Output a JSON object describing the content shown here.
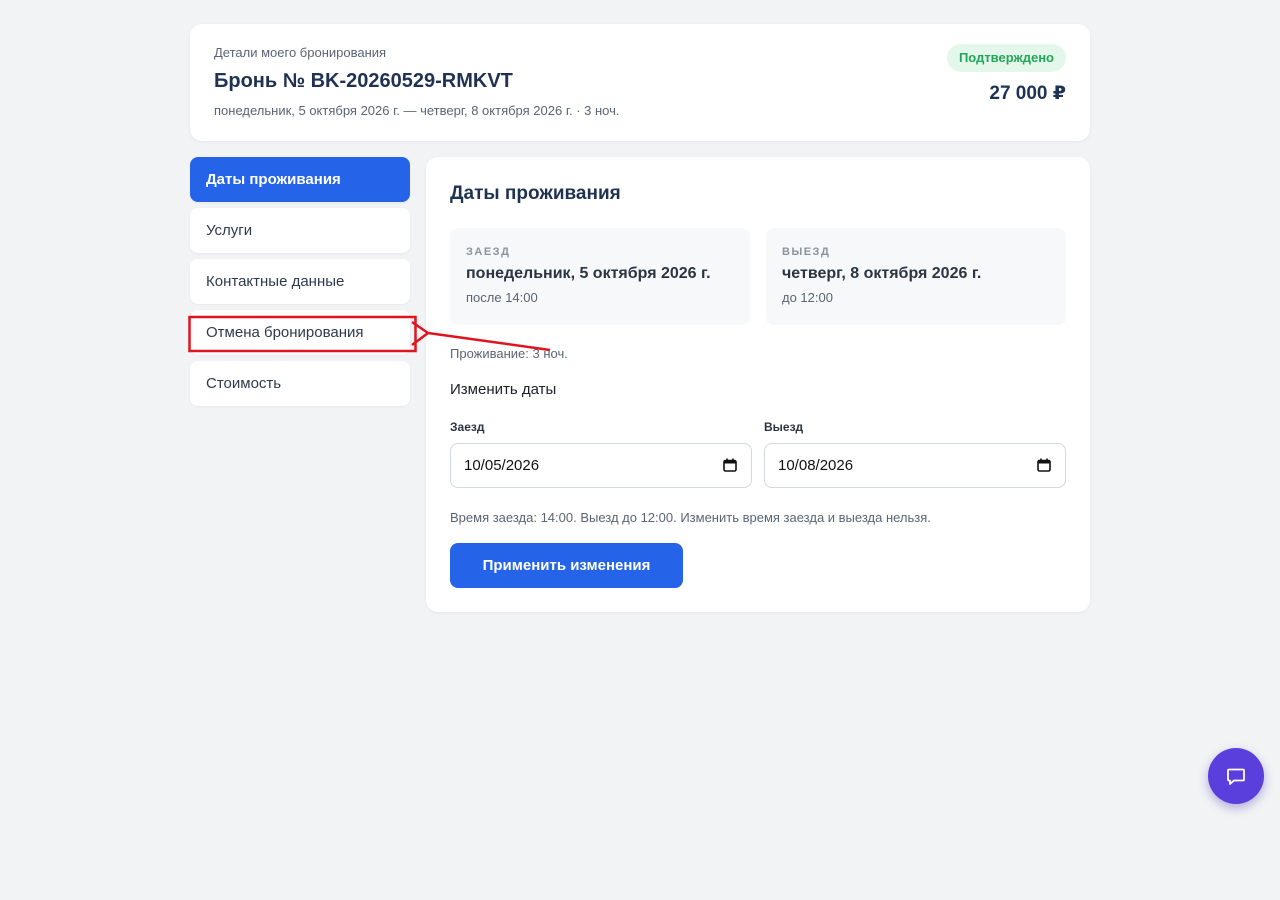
{
  "header": {
    "subtitle": "Детали моего бронирования",
    "title": "Бронь № BK-20260529-RMKVT",
    "dates": "понедельник, 5 октября 2026 г. — четверг, 8 октября 2026 г. · 3 ноч.",
    "status": "Подтверждено",
    "status_color": "#25a55a",
    "price": "27 000 ₽"
  },
  "sidebar": {
    "items": [
      {
        "label": "Даты проживания",
        "active": true
      },
      {
        "label": "Услуги",
        "active": false
      },
      {
        "label": "Контактные данные",
        "active": false
      },
      {
        "label": "Отмена бронирования",
        "active": false
      },
      {
        "label": "Стоимость",
        "active": false
      }
    ]
  },
  "main": {
    "title": "Даты проживания",
    "checkin": {
      "label": "ЗАЕЗД",
      "date": "понедельник, 5 октября 2026 г.",
      "time": "после 14:00"
    },
    "checkout": {
      "label": "ВЫЕЗД",
      "date": "четверг, 8 октября 2026 г.",
      "time": "до 12:00"
    },
    "stay": "Проживание: 3 ноч.",
    "change_title": "Изменить даты",
    "checkin_field": {
      "label": "Заезд",
      "value": "10/05/2026"
    },
    "checkout_field": {
      "label": "Выезд",
      "value": "10/08/2026"
    },
    "hint": "Время заезда: 14:00. Выезд до 12:00. Изменить время заезда и выезда нельзя.",
    "apply_label": "Применить изменения"
  },
  "colors": {
    "accent": "#2563e8",
    "chat": "#5b3fdc",
    "annotation": "#e0141e"
  },
  "icons": {
    "calendar": "calendar-icon",
    "chat": "chat-icon"
  }
}
